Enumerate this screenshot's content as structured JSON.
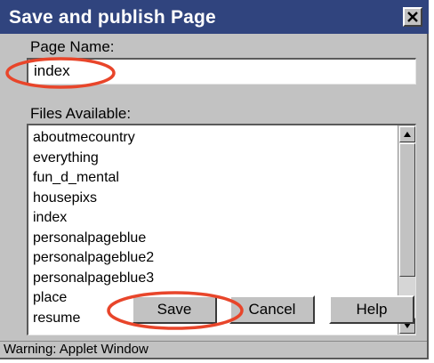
{
  "window": {
    "title": "Save and publish Page"
  },
  "page_name": {
    "label": "Page Name:",
    "value": "index"
  },
  "files": {
    "label": "Files Available:",
    "items": [
      "aboutmecountry",
      "everything",
      "fun_d_mental",
      "housepixs",
      "index",
      "personalpageblue",
      "personalpageblue2",
      "personalpageblue3",
      "place",
      "resume"
    ]
  },
  "buttons": {
    "save": "Save",
    "cancel": "Cancel",
    "help": "Help"
  },
  "status": {
    "text": "Warning: Applet Window"
  },
  "colors": {
    "title_bar": "#30447e",
    "window_bg": "#c2c2c2",
    "highlight": "#e8452a"
  },
  "icons": {
    "close": "close-icon",
    "scroll_up": "arrow-up-icon",
    "scroll_down": "arrow-down-icon"
  }
}
